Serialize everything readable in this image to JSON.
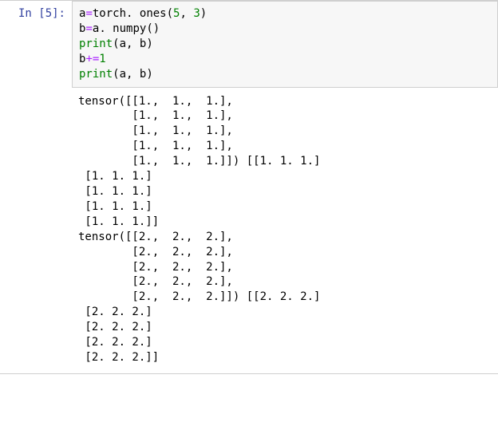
{
  "prompt": "In  [5]:",
  "code": {
    "l1": {
      "a": "a",
      "eq": "=",
      "torch": "torch",
      "dot1": ". ",
      "ones": "ones",
      "open": "(",
      "five": "5",
      "comma": ", ",
      "three": "3",
      "close": ")"
    },
    "l2": {
      "b": "b",
      "eq": "=",
      "a": "a",
      "dot": ". ",
      "numpy": "numpy",
      "open": "(",
      "close": ")"
    },
    "l3": {
      "print": "print",
      "open": "(",
      "a": "a",
      "comma": ", ",
      "b": "b",
      "close": ")"
    },
    "l4": {
      "b": "b",
      "op": "+=",
      "one": "1"
    },
    "l5": {
      "print": "print",
      "open": "(",
      "a": "a",
      "comma": ", ",
      "b": "b",
      "close": ")"
    }
  },
  "output": "tensor([[1.,  1.,  1.],\n        [1.,  1.,  1.],\n        [1.,  1.,  1.],\n        [1.,  1.,  1.],\n        [1.,  1.,  1.]]) [[1. 1. 1.]\n [1. 1. 1.]\n [1. 1. 1.]\n [1. 1. 1.]\n [1. 1. 1.]]\ntensor([[2.,  2.,  2.],\n        [2.,  2.,  2.],\n        [2.,  2.,  2.],\n        [2.,  2.,  2.],\n        [2.,  2.,  2.]]) [[2. 2. 2.]\n [2. 2. 2.]\n [2. 2. 2.]\n [2. 2. 2.]\n [2. 2. 2.]]"
}
